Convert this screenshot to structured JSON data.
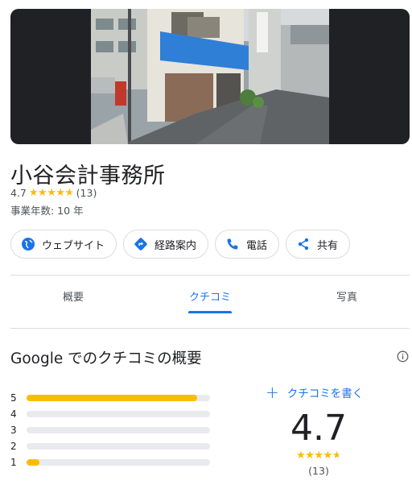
{
  "place": {
    "name": "小谷会計事務所",
    "rating": "4.7",
    "review_count": "(13)",
    "years_in_business": "事業年数: 10 年"
  },
  "actions": [
    {
      "label": "ウェブサイト",
      "icon": "globe-icon"
    },
    {
      "label": "経路案内",
      "icon": "directions-icon"
    },
    {
      "label": "電話",
      "icon": "phone-icon"
    },
    {
      "label": "共有",
      "icon": "share-icon"
    }
  ],
  "tabs": [
    {
      "label": "概要",
      "active": false
    },
    {
      "label": "クチコミ",
      "active": true
    },
    {
      "label": "写真",
      "active": false
    }
  ],
  "reviews_summary": {
    "title": "Google でのクチコミの概要",
    "write_review": "クチコミを書く",
    "score": "4.7",
    "count": "(13)",
    "distribution": [
      {
        "stars": "5",
        "fraction": 0.93
      },
      {
        "stars": "4",
        "fraction": 0.0
      },
      {
        "stars": "3",
        "fraction": 0.0
      },
      {
        "stars": "2",
        "fraction": 0.0
      },
      {
        "stars": "1",
        "fraction": 0.07
      }
    ]
  },
  "colors": {
    "accent": "#1a73e8",
    "star": "#fbbc04",
    "track": "#e8eaed",
    "awning": "#2f7fd6"
  }
}
